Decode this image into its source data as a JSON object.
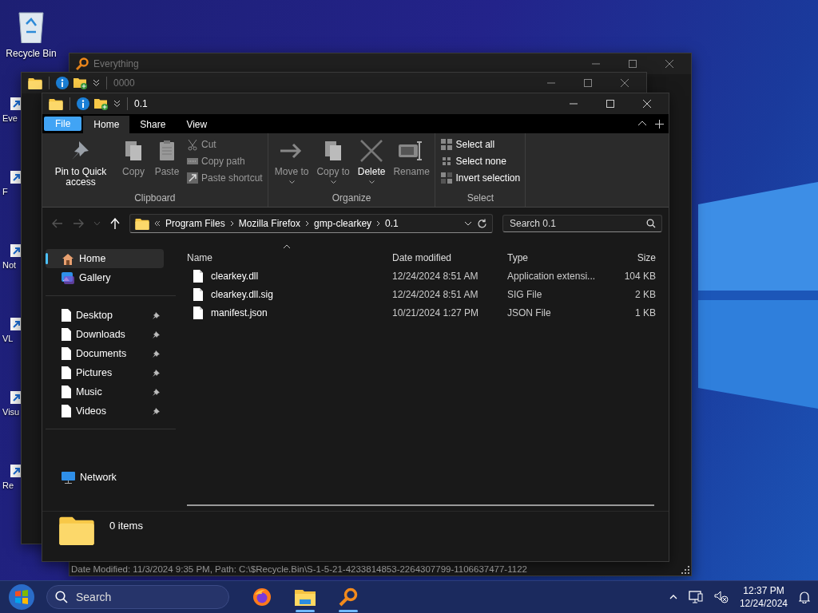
{
  "desktop_icons": [
    {
      "label": "Recycle Bin",
      "kind": "bin"
    },
    {
      "label": "Eve",
      "kind": "shortcut"
    },
    {
      "label": "F",
      "kind": "shortcut"
    },
    {
      "label": "Not",
      "kind": "shortcut"
    },
    {
      "label": "VL",
      "kind": "shortcut"
    },
    {
      "label": "Visu",
      "kind": "shortcut"
    },
    {
      "label": "Re",
      "kind": "shortcut"
    }
  ],
  "back_windows": [
    {
      "kind": "everything",
      "title": "Everything",
      "status_text": "Date Modified: 11/3/2024 9:35 PM, Path: C:\\$Recycle.Bin\\S-1-5-21-4233814853-2264307799-1106637477-1122"
    },
    {
      "kind": "explorer",
      "title": "0000"
    }
  ],
  "explorer": {
    "title": "0.1",
    "tabs": [
      {
        "label": "File",
        "kind": "file",
        "selected": false
      },
      {
        "label": "Home",
        "kind": "tab",
        "selected": true
      },
      {
        "label": "Share",
        "kind": "tab",
        "selected": false
      },
      {
        "label": "View",
        "kind": "tab",
        "selected": false
      }
    ],
    "ribbon": [
      {
        "label": "Clipboard",
        "items": [
          {
            "kind": "large",
            "label": "Pin to Quick access",
            "disabled": false,
            "has_menu": false
          },
          {
            "kind": "large",
            "label": "Copy",
            "disabled": true,
            "has_menu": false
          },
          {
            "kind": "large",
            "label": "Paste",
            "disabled": true,
            "has_menu": false
          },
          {
            "kind": "small",
            "label": "Cut",
            "disabled": true,
            "has_menu": false
          },
          {
            "kind": "small",
            "label": "Copy path",
            "disabled": true,
            "has_menu": false
          },
          {
            "kind": "small",
            "label": "Paste shortcut",
            "disabled": true,
            "has_menu": false
          }
        ]
      },
      {
        "label": "Organize",
        "items": [
          {
            "kind": "large",
            "label": "Move to",
            "disabled": true,
            "has_menu": true
          },
          {
            "kind": "large",
            "label": "Copy to",
            "disabled": true,
            "has_menu": true
          },
          {
            "kind": "large",
            "label": "Delete",
            "disabled": false,
            "has_menu": true
          },
          {
            "kind": "large",
            "label": "Rename",
            "disabled": true,
            "has_menu": false
          }
        ]
      },
      {
        "label": "Select",
        "items": [
          {
            "kind": "small",
            "label": "Select all",
            "disabled": false,
            "has_menu": false
          },
          {
            "kind": "small",
            "label": "Select none",
            "disabled": false,
            "has_menu": false
          },
          {
            "kind": "small",
            "label": "Invert selection",
            "disabled": false,
            "has_menu": false
          }
        ]
      }
    ],
    "address": [
      "Program Files",
      "Mozilla Firefox",
      "gmp-clearkey",
      "0.1"
    ],
    "search": {
      "placeholder": "Search 0.1"
    },
    "sidebar": [
      [
        {
          "label": "Home",
          "kind": "home",
          "selected": true,
          "pinned": false
        },
        {
          "label": "Gallery",
          "kind": "gallery",
          "selected": false,
          "pinned": false
        }
      ],
      [
        {
          "label": "Desktop",
          "kind": "folder",
          "selected": false,
          "pinned": true
        },
        {
          "label": "Downloads",
          "kind": "folder",
          "selected": false,
          "pinned": true
        },
        {
          "label": "Documents",
          "kind": "folder",
          "selected": false,
          "pinned": true
        },
        {
          "label": "Pictures",
          "kind": "folder",
          "selected": false,
          "pinned": true
        },
        {
          "label": "Music",
          "kind": "folder",
          "selected": false,
          "pinned": true
        },
        {
          "label": "Videos",
          "kind": "folder",
          "selected": false,
          "pinned": true
        }
      ],
      [
        {
          "label": "Network",
          "kind": "network",
          "selected": false,
          "pinned": false
        }
      ]
    ],
    "columns": [
      {
        "label": "Name",
        "sorted": true
      },
      {
        "label": "Date modified",
        "sorted": false
      },
      {
        "label": "Type",
        "sorted": false
      },
      {
        "label": "Size",
        "sorted": false
      }
    ],
    "files": [
      {
        "name": "clearkey.dll",
        "date": "12/24/2024 8:51 AM",
        "type": "Application extensi...",
        "size": "104 KB"
      },
      {
        "name": "clearkey.dll.sig",
        "date": "12/24/2024 8:51 AM",
        "type": "SIG File",
        "size": "2 KB"
      },
      {
        "name": "manifest.json",
        "date": "10/21/2024 1:27 PM",
        "type": "JSON File",
        "size": "1 KB"
      }
    ],
    "status": "0 items"
  },
  "taskbar": {
    "search_placeholder": "Search",
    "apps": [
      {
        "kind": "firefox",
        "active": false
      },
      {
        "kind": "explorer",
        "active": true
      },
      {
        "kind": "everything",
        "active": true
      }
    ],
    "time": "12:37 PM",
    "date": "12/24/2024"
  }
}
